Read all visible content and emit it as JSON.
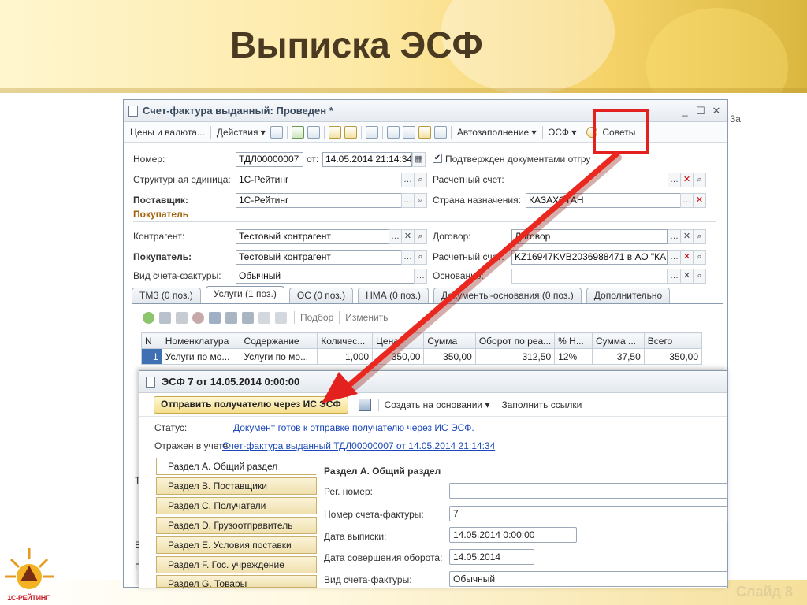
{
  "slide": {
    "title": "Выписка ЭСФ",
    "number": "Слайд 8",
    "logo_text": "1С-РЕЙТИНГ"
  },
  "window": {
    "title": "Счет-фактура выданный: Проведен *",
    "edge_text": "За"
  },
  "toolbar": {
    "prices": "Цены и валюта...",
    "actions": "Действия ▾",
    "autofill": "Автозаполнение ▾",
    "esf": "ЭСФ ▾",
    "tips": "Советы"
  },
  "form": {
    "number_label": "Номер:",
    "number_value": "ТДЛ00000007",
    "from_label": "от:",
    "date_value": "14.05.2014 21:14:34",
    "confirmed_label": "Подтвержден документами отгру",
    "unit_label": "Структурная единица:",
    "unit_value": "1С-Рейтинг",
    "account_label": "Расчетный счет:",
    "supplier_label": "Поставщик:",
    "supplier_value": "1С-Рейтинг",
    "country_label": "Страна назначения:",
    "country_value": "КАЗАХСТАН",
    "buyer_section": "Покупатель",
    "counterparty_label": "Контрагент:",
    "counterparty_value": "Тестовый контрагент",
    "contract_label": "Договор:",
    "contract_value": "Договор",
    "buyer_label": "Покупатель:",
    "buyer_value": "Тестовый контрагент",
    "buyer_account_label": "Расчетный счет:",
    "buyer_account_value": "KZ16947KVB2036988471 в АО \"КА...",
    "invoice_type_label": "Вид счета-фактуры:",
    "invoice_type_value": "Обычный",
    "basis_label": "Основание:"
  },
  "tabs": [
    {
      "label": "ТМЗ (0 поз.)"
    },
    {
      "label": "Услуги (1 поз.)"
    },
    {
      "label": "ОС (0 поз.)"
    },
    {
      "label": "НМА (0 поз.)"
    },
    {
      "label": "Документы-основания (0 поз.)"
    },
    {
      "label": "Дополнительно"
    }
  ],
  "grid_toolbar": {
    "select": "Подбор",
    "change": "Изменить"
  },
  "grid": {
    "columns": [
      "N",
      "Номенклатура",
      "Содержание",
      "Количес...",
      "Цена",
      "Сумма",
      "Оборот по реа...",
      "% Н...",
      "Сумма ...",
      "Всего"
    ],
    "rows": [
      [
        "1",
        "Услуги по мо...",
        "Услуги по мо...",
        "1,000",
        "350,00",
        "350,00",
        "312,50",
        "12%",
        "37,50",
        "350,00"
      ]
    ]
  },
  "esf": {
    "title": "ЭСФ 7 от 14.05.2014 0:00:00",
    "send_button": "Отправить получателю через ИС ЭСФ",
    "create_based": "Создать на основании ▾",
    "fill_links": "Заполнить ссылки",
    "status_label": "Статус:",
    "status_link": "Документ готов к отправке получателю через ИС ЭСФ.",
    "reflected_label": "Отражен в учете:",
    "reflected_link": "Счет-фактура выданный ТДЛ00000007 от 14.05.2014 21:14:34",
    "sections": [
      {
        "label": "Раздел А. Общий раздел"
      },
      {
        "label": "Раздел B. Поставщики"
      },
      {
        "label": "Раздел C. Получатели"
      },
      {
        "label": "Раздел D. Грузоотправитель"
      },
      {
        "label": "Раздел E. Условия поставки"
      },
      {
        "label": "Раздел F. Гос. учреждение"
      },
      {
        "label": "Раздел G. Товары"
      }
    ],
    "section_title": "Раздел А. Общий раздел",
    "reg_label": "Рег. номер:",
    "reg_value": "",
    "invoice_no_label": "Номер счета-фактуры:",
    "invoice_no_value": "7",
    "issue_date_label": "Дата выписки:",
    "issue_date_value": "14.05.2014  0:00:00",
    "turnover_date_label": "Дата совершения оборота:",
    "turnover_date_value": "14.05.2014",
    "type_label": "Вид счета-фактуры:",
    "type_value": "Обычный"
  },
  "behind_letters": [
    "Т",
    "В",
    "П"
  ],
  "colors": {
    "highlight_red": "#e3211f",
    "selection_blue": "#3f70b4",
    "title_brown": "#4a3a22",
    "link_blue": "#1a47b8"
  }
}
